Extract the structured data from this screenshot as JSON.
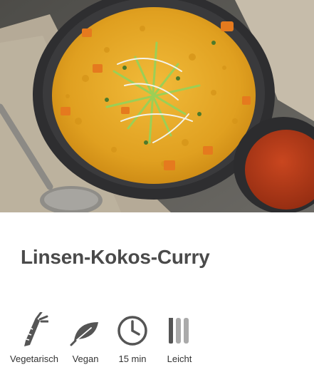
{
  "recipe": {
    "title": "Linsen-Kokos-Curry"
  },
  "features": [
    {
      "label": "Vegetarisch",
      "icon": "carrot-icon"
    },
    {
      "label": "Vegan",
      "icon": "leaf-icon"
    },
    {
      "label": "15 min",
      "icon": "clock-icon"
    },
    {
      "label": "Leicht",
      "icon": "cutlery-icon"
    }
  ],
  "colors": {
    "title": "#4a4a4a",
    "icon": "#555555",
    "curry": "#e0a21c",
    "paste": "#b4381a"
  }
}
